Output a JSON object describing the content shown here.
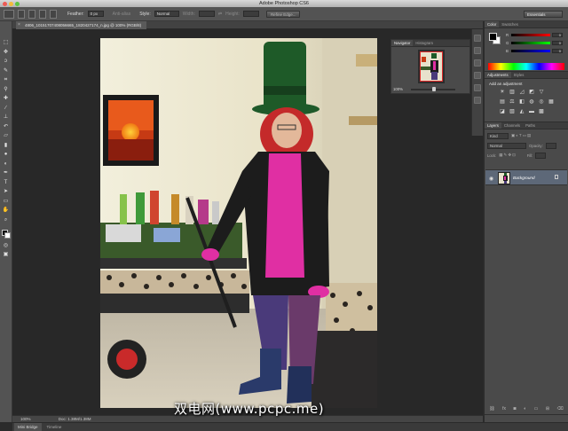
{
  "titlebar": {
    "title": "Adobe Photoshop CS6"
  },
  "options_bar": {
    "feather_label": "Feather:",
    "feather_value": "0 px",
    "antialias_label": "Anti-alias",
    "style_label": "Style:",
    "style_value": "Normal",
    "width_label": "Width:",
    "height_label": "Height:",
    "refine_edge_label": "Refine Edge...",
    "workspace": "Essentials"
  },
  "document": {
    "tab_title": "4806_10151707408056665_1820427174_n.jpg @ 100% (RGB/8)",
    "close_glyph": "×"
  },
  "statusbar": {
    "zoom": "100%",
    "doc_info": "Doc: 1.38M/1.38M"
  },
  "bottom_tabs": [
    "Mini Bridge",
    "Timeline"
  ],
  "navigator": {
    "tabs": [
      "Navigator",
      "Histogram"
    ],
    "zoom": "100%"
  },
  "color_panel": {
    "tabs": [
      "Color",
      "Swatches"
    ],
    "channels": [
      {
        "label": "R",
        "value": "0"
      },
      {
        "label": "G",
        "value": "0"
      },
      {
        "label": "B",
        "value": "0"
      }
    ]
  },
  "adjustments": {
    "tabs": [
      "Adjustments",
      "Styles"
    ],
    "title": "Add an adjustment"
  },
  "layers": {
    "tabs": [
      "Layers",
      "Channels",
      "Paths"
    ],
    "kind_filter": "Kind",
    "blend_mode": "Normal",
    "opacity_label": "Opacity:",
    "lock_label": "Lock:",
    "fill_label": "Fill:",
    "layer_name": "Background"
  },
  "watermark": "双电网(www.pcpc.me)",
  "colors": {
    "panel_bg": "#4a4a4a",
    "canvas_bg": "#282828",
    "selected_layer": "#5d6878"
  },
  "icons": [
    "marquee-icon",
    "move-icon",
    "lasso-icon",
    "quick-select-icon",
    "crop-icon",
    "eyedropper-icon",
    "healing-brush-icon",
    "brush-icon",
    "clone-stamp-icon",
    "history-brush-icon",
    "eraser-icon",
    "gradient-icon",
    "blur-icon",
    "dodge-icon",
    "pen-icon",
    "type-icon",
    "path-select-icon",
    "shape-icon",
    "hand-icon",
    "zoom-icon"
  ]
}
